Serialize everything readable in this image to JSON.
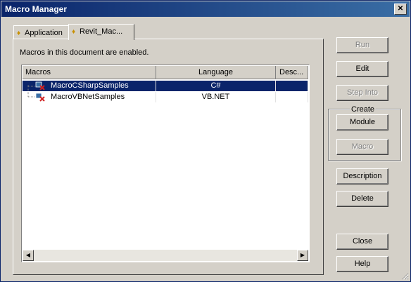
{
  "window": {
    "title": "Macro Manager",
    "close_symbol": "✕"
  },
  "tabs": [
    {
      "label": "Application",
      "icon": "lightbulb-icon"
    },
    {
      "label": "Revit_Mac...",
      "icon": "lightbulb-icon"
    }
  ],
  "status_text": "Macros in this document are enabled.",
  "table": {
    "headers": [
      "Macros",
      "Language",
      "Desc..."
    ],
    "rows": [
      {
        "name": "MacroCSharpSamples",
        "language": "C#",
        "description": "",
        "selected": true
      },
      {
        "name": "MacroVBNetSamples",
        "language": "VB.NET",
        "description": "",
        "selected": false
      }
    ]
  },
  "buttons": {
    "run": {
      "label": "Run",
      "enabled": false
    },
    "edit": {
      "label": "Edit",
      "enabled": true
    },
    "step_into": {
      "label": "Step Into",
      "enabled": false
    },
    "module": {
      "label": "Module",
      "enabled": true
    },
    "macro": {
      "label": "Macro",
      "enabled": false
    },
    "description": {
      "label": "Description",
      "enabled": true
    },
    "delete": {
      "label": "Delete",
      "enabled": true
    },
    "close": {
      "label": "Close",
      "enabled": true
    },
    "help": {
      "label": "Help",
      "enabled": true
    }
  },
  "create_group": {
    "label": "Create"
  },
  "scrollbar": {
    "left_arrow": "◀",
    "right_arrow": "▶"
  },
  "colors": {
    "title_bar": "#0a246a",
    "selection": "#0a246a",
    "face": "#d4d0c8"
  }
}
